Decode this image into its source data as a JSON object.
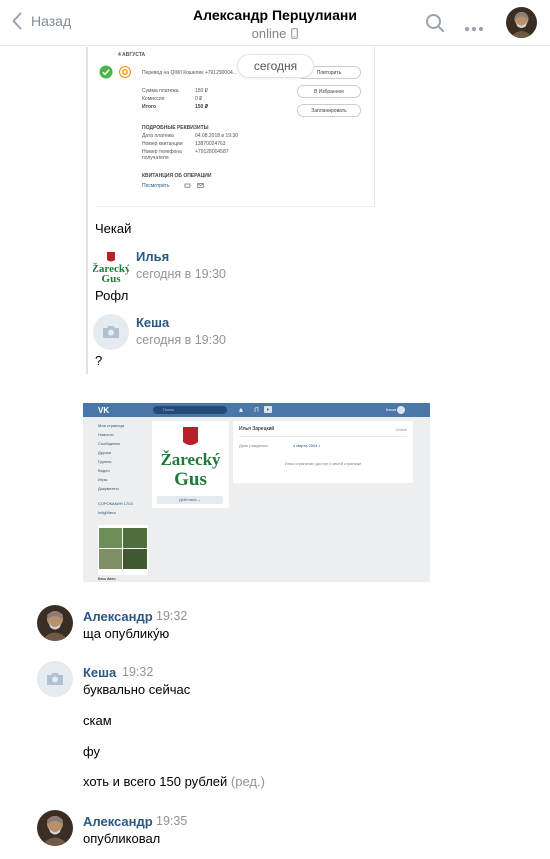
{
  "header": {
    "back_label": "Назад",
    "title": "Александр Перцулиани",
    "status": "online"
  },
  "date_divider": "сегодня",
  "receipt": {
    "date_heading": "4 АВГУСТА",
    "operation": "Перевод на QIWI Кошелек +791290004...",
    "rows": [
      {
        "label": "Сумма платежа",
        "value": "150 ₽"
      },
      {
        "label": "Комиссия",
        "value": "0 ₽"
      },
      {
        "label": "Итого",
        "value": "150 ₽"
      }
    ],
    "details_heading": "ПОДРОБНЫЕ РЕКВИЗИТЫ",
    "details": [
      {
        "label": "Дата платежа",
        "value": "04.08.2018 в 19:30"
      },
      {
        "label": "Номер квитанции",
        "value": "13870024763"
      },
      {
        "label": "Номер телефона получателя",
        "value": "+79128004587"
      }
    ],
    "receipt_heading": "КВИТАНЦИЯ ОБ ОПЕРАЦИИ",
    "receipt_link": "Посмотреть",
    "buttons": [
      "Повторить",
      "В Избранное",
      "Запланировать"
    ]
  },
  "forwarded": {
    "caption": "Чекай",
    "messages": [
      {
        "sender": "Илья",
        "time": "сегодня в 19:30",
        "text": "Рофл"
      },
      {
        "sender": "Кеша",
        "time": "сегодня в 19:30",
        "text": "?"
      }
    ]
  },
  "screenshot": {
    "search_placeholder": "Поиск",
    "user_short": "Кеша",
    "menu": [
      "Моя страница",
      "Новости",
      "Сообщения",
      "Друзья",
      "Группы",
      "Видео",
      "Игры",
      "Документы",
      "СОРОКАКИН 1703",
      "InfiglViera"
    ],
    "profile_name": "Илья Зарецкий",
    "profile_status": "Online",
    "birthday_label": "День рождения:",
    "birthday_value": "4 марта 2004 г.",
    "private_note": "Илья ограничил доступ к своей странице",
    "actions_label": "Действия ⌄",
    "photos_label": "Кеш Авто"
  },
  "messages": [
    {
      "sender": "Александр",
      "time": "19:32",
      "lines": [
        "ща опублику́ю"
      ]
    },
    {
      "sender": "Кеша",
      "time": "19:32",
      "lines": [
        "буквально сейчас",
        "скам",
        "фу",
        "хоть и всего 150 рублей"
      ],
      "edited": "(ред.)"
    },
    {
      "sender": "Александр",
      "time": "19:35",
      "lines": [
        "опубликовал"
      ]
    }
  ],
  "colors": {
    "link": "#2a5885",
    "accent": "#4a76a8",
    "muted": "#939393",
    "zarecky_red": "#b8202a",
    "zarecky_green": "#1f7a3a"
  }
}
